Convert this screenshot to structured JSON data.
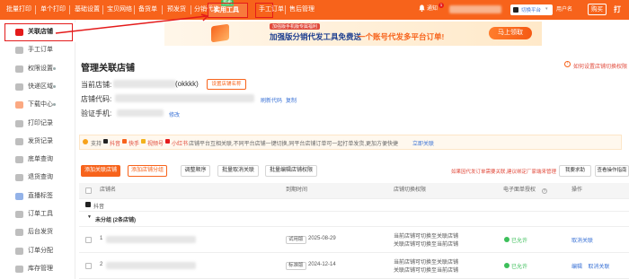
{
  "topnav": {
    "items": [
      {
        "label": "批量打印"
      },
      {
        "label": "单个打印"
      },
      {
        "label": "基础设置"
      },
      {
        "label": "宝贝网络"
      },
      {
        "label": "备货单"
      },
      {
        "label": "预发货"
      },
      {
        "label": "分销代发"
      },
      {
        "label": "实用工具"
      },
      {
        "label": "手工订单"
      },
      {
        "label": "售后管理"
      }
    ],
    "new_badge": "热卖",
    "notice": "通知",
    "notice_count": "1",
    "platform_btn": "切换平台",
    "user_btn": "用户名",
    "buy_btn": "购买",
    "extra": "打"
  },
  "sidebar": {
    "items": [
      {
        "label": "关联店铺"
      },
      {
        "label": "手工订单"
      },
      {
        "label": "权限设置"
      },
      {
        "label": "快递区域"
      },
      {
        "label": "下载中心"
      },
      {
        "label": "打印记录"
      },
      {
        "label": "发货记录"
      },
      {
        "label": "底单查询"
      },
      {
        "label": "退货查询"
      },
      {
        "label": "直播标签"
      },
      {
        "label": "订单工具"
      },
      {
        "label": "后台发货"
      },
      {
        "label": "订单分配"
      },
      {
        "label": "库存管理"
      }
    ]
  },
  "banner": {
    "small": "加强版手机版专属福利",
    "main": "加强版分销代发工具免费送",
    "tagline": "一个账号代发多平台订单!",
    "cta": "马上领取"
  },
  "page": {
    "title": "管理关联店铺",
    "help_link": "如何设置店铺切换权限",
    "current_shop_label": "当前店铺:",
    "current_shop_value": "(okkkk)",
    "shop_name_btn": "设置店铺名称",
    "shop_code_label": "店铺代码:",
    "refresh_link": "刷新代码",
    "copy_link": "复制",
    "phone_label": "验证手机:",
    "modify_link": "修改"
  },
  "support": {
    "prefix": "支持",
    "platforms": [
      "抖音",
      "快手",
      "视频号",
      "小红书"
    ],
    "desc": "店铺平台互相关联,不同平台店铺一键切换,同平台店铺订单可一起打单发货,更加方便快捷",
    "link": "立即关联"
  },
  "toolbar": {
    "add": "添加关联店铺",
    "add_group": "添加店铺分组",
    "reorder": "调整顺序",
    "batch_cancel": "批量取消关联",
    "batch_edit": "批量编辑店铺权限",
    "notice": "如果因代发订单需要关联,建议绑定厂家端来管理",
    "need_help": "我要求助",
    "guide": "查看操作指南"
  },
  "table": {
    "headers": [
      "店铺名",
      "到期时间",
      "店铺切换权限",
      "电子面单授权",
      "操作"
    ],
    "platform_group": "抖音",
    "group_label": "未分组 (2条店铺)",
    "rows": [
      {
        "name_prefix": "1",
        "version": "试用版",
        "expire": "2025-08-29",
        "perm1": "当前店铺可切换至关联店铺",
        "perm2": "关联店铺可切换至当前店铺",
        "auth": "已允许",
        "ops": [
          "取消关联"
        ]
      },
      {
        "name_prefix": "2",
        "version": "标准版",
        "expire": "2024-12-14",
        "perm1": "当前店铺可切换至关联店铺",
        "perm2": "关联店铺可切换至当前店铺",
        "auth": "已允许",
        "ops": [
          "编辑",
          "取消关联"
        ]
      }
    ]
  },
  "colors": {
    "brand": "#f7631b",
    "highlight": "#e41b1b",
    "link": "#3b73d6",
    "ok": "#3cbf5a"
  }
}
